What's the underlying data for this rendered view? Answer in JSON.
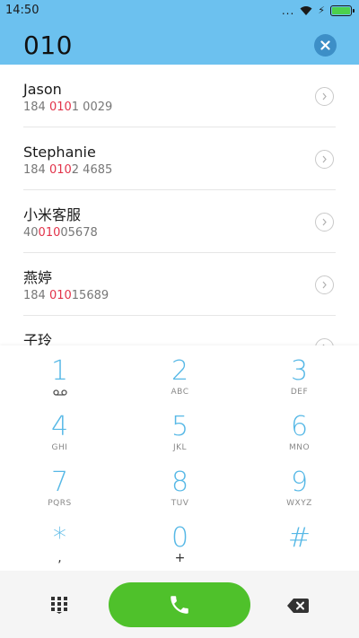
{
  "status_bar": {
    "time": "14:50",
    "dots": "...",
    "icons": [
      "wifi-icon",
      "charging-bolt-icon",
      "battery-icon"
    ],
    "battery_percent": 100
  },
  "dialer": {
    "query": "010",
    "clear_icon": "close-icon"
  },
  "contacts": [
    {
      "name": "Jason",
      "number_pre": "184 ",
      "number_hl": "010",
      "number_post": "1 0029"
    },
    {
      "name": "Stephanie",
      "number_pre": "184 ",
      "number_hl": "010",
      "number_post": "2 4685"
    },
    {
      "name": "小米客服",
      "number_pre": "40",
      "number_hl": "010",
      "number_post": "05678"
    },
    {
      "name": "燕婷",
      "number_pre": "184 ",
      "number_hl": "010",
      "number_post": "15689"
    },
    {
      "name": "子玲",
      "number_pre": "",
      "number_hl": "",
      "number_post": ""
    }
  ],
  "keypad": {
    "keys": [
      {
        "digit": "1",
        "sub": "voicemail-icon"
      },
      {
        "digit": "2",
        "sub": "ABC"
      },
      {
        "digit": "3",
        "sub": "DEF"
      },
      {
        "digit": "4",
        "sub": "GHI"
      },
      {
        "digit": "5",
        "sub": "JKL"
      },
      {
        "digit": "6",
        "sub": "MNO"
      },
      {
        "digit": "7",
        "sub": "PQRS"
      },
      {
        "digit": "8",
        "sub": "TUV"
      },
      {
        "digit": "9",
        "sub": "WXYZ"
      },
      {
        "digit": "*",
        "sub": ","
      },
      {
        "digit": "0",
        "sub": "+"
      },
      {
        "digit": "#",
        "sub": ""
      }
    ]
  },
  "actions": {
    "keypad_toggle_icon": "dialpad-grid-icon",
    "call_icon": "phone-icon",
    "backspace_icon": "backspace-icon"
  },
  "colors": {
    "header_bg": "#6cc1ef",
    "highlight": "#e2334a",
    "key_digit": "#56b8e6",
    "call_green": "#4fc12b",
    "clear_button": "#3d8fc7"
  }
}
